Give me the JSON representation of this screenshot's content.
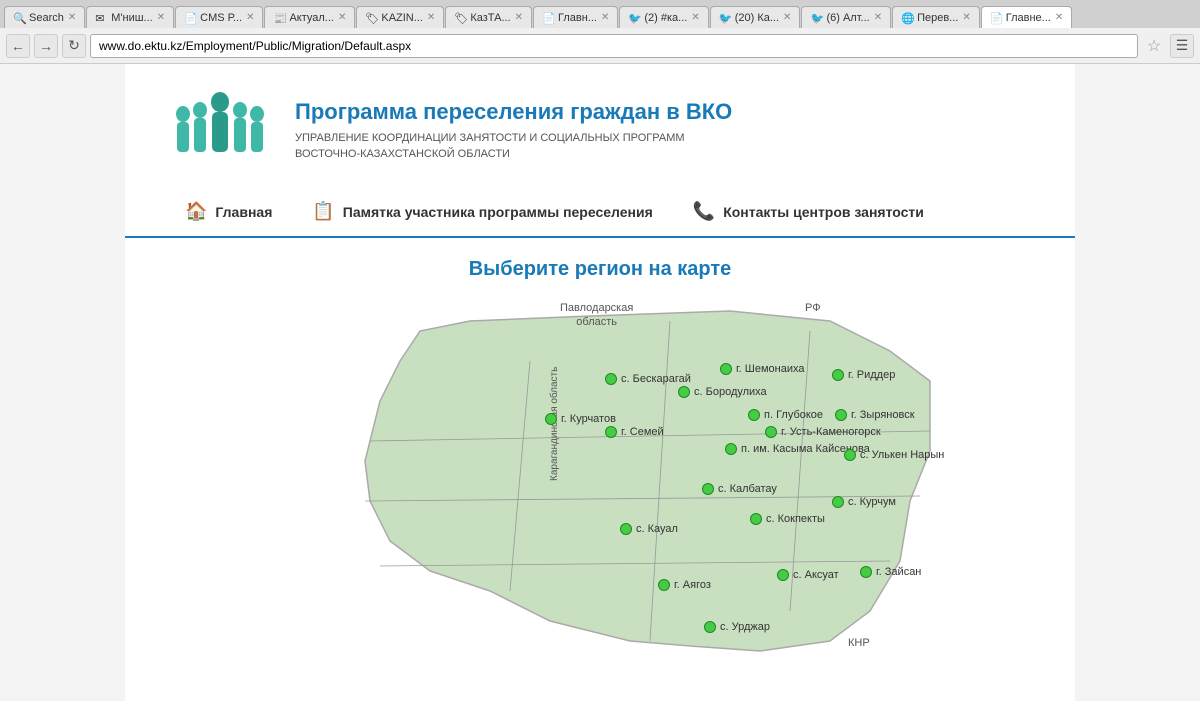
{
  "browser": {
    "tabs": [
      {
        "label": "Search",
        "icon": "🔍",
        "active": false
      },
      {
        "label": "М'ниш...",
        "icon": "✉",
        "active": false
      },
      {
        "label": "CMS Р...",
        "icon": "📄",
        "active": false
      },
      {
        "label": "Актуал...",
        "icon": "📰",
        "active": false
      },
      {
        "label": "KAZIN...",
        "icon": "🏷",
        "active": false
      },
      {
        "label": "КазТА...",
        "icon": "🏷",
        "active": false
      },
      {
        "label": "Главн...",
        "icon": "📄",
        "active": false
      },
      {
        "label": "(2) #ка...",
        "icon": "🐦",
        "active": false
      },
      {
        "label": "(20) Ка...",
        "icon": "🐦",
        "active": false
      },
      {
        "label": "(6) Алт...",
        "icon": "🐦",
        "active": false
      },
      {
        "label": "Перев...",
        "icon": "🌐",
        "active": false
      },
      {
        "label": "Главне...",
        "icon": "📄",
        "active": true
      }
    ],
    "address": "www.do.ektu.kz/Employment/Public/Migration/Default.aspx"
  },
  "header": {
    "title": "Программа переселения граждан в ВКО",
    "subtitle_line1": "УПРАВЛЕНИЕ КООРДИНАЦИИ ЗАНЯТОСТИ И СОЦИАЛЬНЫХ ПРОГРАММ",
    "subtitle_line2": "ВОСТОЧНО-КАЗАХСТАНСКОЙ ОБЛАСТИ"
  },
  "nav": {
    "items": [
      {
        "label": "Главная",
        "icon": "🏠"
      },
      {
        "label": "Памятка участника программы переселения",
        "icon": "📋"
      },
      {
        "label": "Контакты центров занятости",
        "icon": "📞"
      }
    ]
  },
  "map": {
    "title": "Выберите регион на карте",
    "region_labels": [
      {
        "label": "Павлодарская\nобласть",
        "left": "340",
        "top": "20"
      },
      {
        "label": "РФ",
        "left": "570",
        "top": "10"
      },
      {
        "label": "Карагандинская область",
        "left": "305",
        "top": "280"
      },
      {
        "label": "КНР",
        "left": "620",
        "top": "340"
      }
    ],
    "cities": [
      {
        "name": "с. Бескарагай",
        "left": "390",
        "top": "80"
      },
      {
        "name": "г. Шемонаиха",
        "left": "510",
        "top": "73"
      },
      {
        "name": "г. Риддер",
        "left": "625",
        "top": "80"
      },
      {
        "name": "с. Бородулиха",
        "left": "475",
        "top": "95"
      },
      {
        "name": "г. Курчатов",
        "left": "340",
        "top": "118"
      },
      {
        "name": "г. Семей",
        "left": "405",
        "top": "128"
      },
      {
        "name": "п. Глубокое",
        "left": "545",
        "top": "120"
      },
      {
        "name": "г. Зыряновск",
        "left": "640",
        "top": "120"
      },
      {
        "name": "г. Усть-Каменогорск",
        "left": "575",
        "top": "135"
      },
      {
        "name": "п. им. Касыма Кайсенова",
        "left": "530",
        "top": "148"
      },
      {
        "name": "с. Улькен Нарын",
        "left": "650",
        "top": "155"
      },
      {
        "name": "с. Калбатау",
        "left": "500",
        "top": "185"
      },
      {
        "name": "с. Курчум",
        "left": "635",
        "top": "205"
      },
      {
        "name": "с. Кокпекты",
        "left": "555",
        "top": "220"
      },
      {
        "name": "с. Кауал",
        "left": "415",
        "top": "230"
      },
      {
        "name": "г. Аягоз",
        "left": "455",
        "top": "285"
      },
      {
        "name": "с. Аксуат",
        "left": "578",
        "top": "275"
      },
      {
        "name": "г. Зайсан",
        "left": "660",
        "top": "275"
      },
      {
        "name": "с. Урджар",
        "left": "502",
        "top": "325"
      }
    ]
  }
}
